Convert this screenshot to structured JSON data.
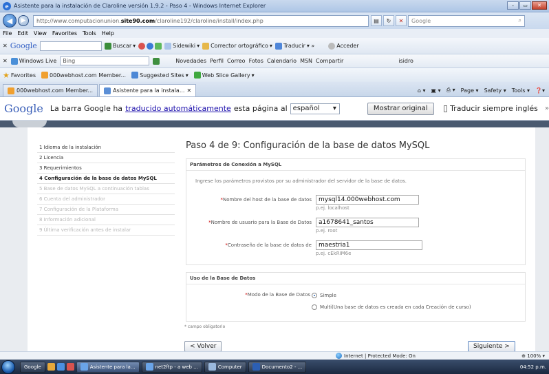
{
  "window": {
    "title": "Asistente para la instalación de Claroline versión 1.9.2 - Paso 4 - Windows Internet Explorer"
  },
  "address": {
    "url_prefix": "http://www.computacionunion.",
    "url_domain": "site90.com",
    "url_suffix": "/claroline192/claroline/install/index.php",
    "search_placeholder": "Google"
  },
  "menu": {
    "items": [
      "File",
      "Edit",
      "View",
      "Favorites",
      "Tools",
      "Help"
    ]
  },
  "google_toolbar": {
    "logo": "Google",
    "buscar": "Buscar",
    "sidewiki": "Sidewiki",
    "corrector": "Corrector ortográfico",
    "traducir": "Traducir",
    "acceder": "Acceder"
  },
  "links_bar": {
    "windows_live": "Windows Live",
    "bing_placeholder": "Bing",
    "items": [
      "Novedades",
      "Perfil",
      "Correo",
      "Fotos",
      "Calendario",
      "MSN",
      "Compartir"
    ],
    "user": "isidro"
  },
  "favorites_bar": {
    "favorites": "Favorites",
    "member": "000webhost.com Member...",
    "suggested": "Suggested Sites",
    "slice": "Web Slice Gallery"
  },
  "tabs": {
    "items": [
      "000webhost.com Member...",
      "Asistente para la instala..."
    ],
    "tools": [
      "Page",
      "Safety",
      "Tools"
    ]
  },
  "translate_bar": {
    "logo": "Google",
    "text_before": "La barra Google ha",
    "link": "traducido automáticamente",
    "text_after": "esta página al",
    "language": "español",
    "show_original": "Mostrar original",
    "always_translate": "Traducir siempre inglés"
  },
  "steps": [
    {
      "label": "1  Idioma de la instalación",
      "state": "done"
    },
    {
      "label": "2  Licencia",
      "state": "done"
    },
    {
      "label": "3  Requerimientos",
      "state": "done"
    },
    {
      "label": "4  Configuración de la base de datos MySQL",
      "state": "current"
    },
    {
      "label": "5  Base de datos MySQL a continuación tablas",
      "state": "future"
    },
    {
      "label": "6  Cuenta del administrador",
      "state": "future"
    },
    {
      "label": "7  Configuración de la Plataforma",
      "state": "future"
    },
    {
      "label": "8  Información adicional",
      "state": "future"
    },
    {
      "label": "9  Última verificación antes de instalar",
      "state": "future"
    }
  ],
  "main": {
    "title": "Paso 4 de 9: Configuración de la base de datos MySQL",
    "connection_section": {
      "title": "Parámetros de Conexión a MySQL",
      "description": "Ingrese los parámetros provistos por su administrador del servidor de la base de datos.",
      "fields": [
        {
          "label": "Nombre del host de la base de datos",
          "value": "mysql14.000webhost.com",
          "hint": "p.ej. localhost"
        },
        {
          "label": "Nombre de usuario para la Base de Datos",
          "value": "a1678641_santos",
          "hint": "p.ej. root"
        },
        {
          "label": "Contraseña de la base de datos de",
          "value": "maestria1",
          "hint": "p.ej. cEkRIM6e"
        }
      ]
    },
    "db_section": {
      "title": "Uso de la Base de Datos",
      "mode_label": "Modo de la Base de Datos",
      "option_simple": "Simple",
      "option_multi": "Multi(Una base de datos es creada en cada Creación de curso)"
    },
    "required_note": "* campo obligatorio",
    "back_button": "< Volver",
    "next_button": "Siguiente >"
  },
  "statusbar": {
    "zone": "Internet | Protected Mode: On",
    "zoom": "100%"
  },
  "taskbar": {
    "google": "Google",
    "items": [
      "Asistente para la...",
      "net2ftp - a web ...",
      "Computer",
      "Documento2 - ..."
    ],
    "clock": "04:52 p.m."
  }
}
